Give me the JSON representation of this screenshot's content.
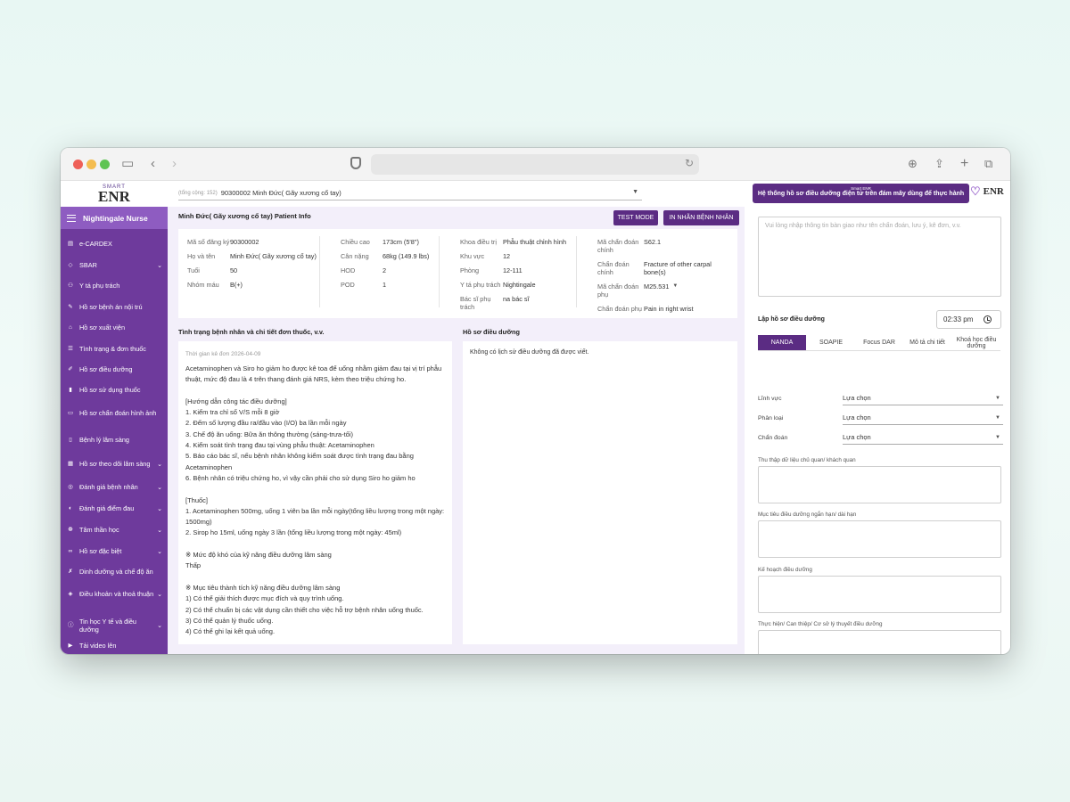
{
  "colors": {
    "primary": "#6e3a9c",
    "accent": "#5b2c83",
    "header": "#8e5cc1",
    "bg": "#f3effa"
  },
  "logo": {
    "small": "SMART",
    "big": "ENR"
  },
  "sidebar": {
    "title": "Nightingale Nurse",
    "items": [
      {
        "label": "e-CARDEX",
        "icon": "card-icon",
        "chevron": false
      },
      {
        "label": "SBAR",
        "icon": "diamond-icon",
        "chevron": true
      },
      {
        "label": "Y tá phụ trách",
        "icon": "people-icon",
        "chevron": false
      },
      {
        "label": "Hồ sơ bệnh án nội trú",
        "icon": "edit-icon",
        "chevron": false
      },
      {
        "label": "Hồ sơ xuất viện",
        "icon": "home-icon",
        "chevron": false
      },
      {
        "label": "Tình trạng & đơn thuốc",
        "icon": "list-icon",
        "chevron": false
      },
      {
        "label": "Hồ sơ điều dưỡng",
        "icon": "pen-icon",
        "chevron": false
      },
      {
        "label": "Hồ sơ sử dụng thuốc",
        "icon": "pill-icon",
        "chevron": false
      },
      {
        "label": "Hồ sơ chẩn đoán hình ảnh",
        "icon": "monitor-icon",
        "chevron": false
      },
      {
        "label": "Bệnh lý lâm sàng",
        "icon": "doc-icon",
        "chevron": false
      },
      {
        "label": "Hồ sơ theo dõi lâm sàng",
        "icon": "chart-icon",
        "chevron": true
      },
      {
        "label": "Đánh giá bệnh nhân",
        "icon": "target-icon",
        "chevron": true
      },
      {
        "label": "Đánh giá điểm đau",
        "icon": "scale-icon",
        "chevron": true
      },
      {
        "label": "Tâm thần học",
        "icon": "brain-icon",
        "chevron": true
      },
      {
        "label": "Hồ sơ đặc biệt",
        "icon": "glasses-icon",
        "chevron": true
      },
      {
        "label": "Dinh dưỡng và chế độ ăn",
        "icon": "food-icon",
        "chevron": false
      },
      {
        "label": "Điều khoản và thoả thuận",
        "icon": "shield-icon",
        "chevron": true
      },
      {
        "label": "Tin học Y tế và điều dưỡng",
        "icon": "info-icon",
        "chevron": true
      },
      {
        "label": "Tải video lên",
        "icon": "video-icon",
        "chevron": false
      }
    ]
  },
  "patient_select": {
    "count": "(tổng cộng: 152)",
    "value": "90300002 Minh Đức( Gãy xương cổ tay)"
  },
  "info_bar": {
    "title": "Minh Đức( Gãy xương cổ tay) Patient Info",
    "test_mode": "TEST MODE",
    "print_label": "IN NHÃN BỆNH NHÂN"
  },
  "patient_info": {
    "col1": [
      {
        "k": "Mã số đăng ký",
        "v": "90300002"
      },
      {
        "k": "Họ và tên",
        "v": "Minh Đức( Gãy xương cổ tay)"
      },
      {
        "k": "Tuổi",
        "v": "50"
      },
      {
        "k": "Nhóm máu",
        "v": "B(+)"
      }
    ],
    "col2": [
      {
        "k": "Chiều cao",
        "v": "173cm (5'8\")"
      },
      {
        "k": "Cân nặng",
        "v": "68kg (149.9 lbs)"
      },
      {
        "k": "HOD",
        "v": "2"
      },
      {
        "k": "POD",
        "v": "1"
      }
    ],
    "col3": [
      {
        "k": "Khoa điều trị",
        "v": "Phẫu thuật chỉnh hình"
      },
      {
        "k": "Khu vực",
        "v": "12"
      },
      {
        "k": "Phòng",
        "v": "12-111"
      },
      {
        "k": "Y tá phụ trách",
        "v": "Nightingale"
      },
      {
        "k": "Bác sĩ phụ trách",
        "v": "na bác sĩ"
      }
    ],
    "col4": [
      {
        "k": "Mã chẩn đoán chính",
        "v": "S62.1"
      },
      {
        "k": "Chẩn đoán chính",
        "v": "Fracture of other carpal bone(s)"
      },
      {
        "k": "Mã chẩn đoán phụ",
        "v": "M25.531"
      },
      {
        "k": "Chẩn đoán phụ",
        "v": "Pain in right wrist"
      }
    ]
  },
  "prescription": {
    "title": "Tình trạng bệnh nhân và chi tiết đơn thuốc, v.v.",
    "date": "Thời gian kê đơn 2026-04-09",
    "text": "Acetaminophen và Siro ho giảm ho được kê toa để uống nhằm giảm đau tại vị trí phẫu thuật, mức độ đau là 4 trên thang đánh giá NRS, kèm theo triệu chứng ho.\n\n[Hướng dẫn công tác điều dưỡng]\n1. Kiểm tra chỉ số V/S mỗi 8 giờ\n2. Đếm số lượng đầu ra/đầu vào (I/O) ba lần mỗi ngày\n3. Chế độ ăn uống: Bữa ăn thông thường (sáng-trưa-tối)\n4. Kiểm soát tình trạng đau tại vùng phẫu thuật: Acetaminophen\n5. Báo cáo bác sĩ, nếu bệnh nhân không kiểm soát được tình trạng đau bằng Acetaminophen\n6. Bệnh nhân có triệu chứng ho, vì vậy cần phải cho sử dụng Siro ho giảm ho\n\n[Thuốc]\n1. Acetaminophen 500mg, uống 1 viên ba lần mỗi ngày(tổng liều lượng trong một ngày: 1500mg)\n2. Sirop ho 15ml, uống ngày 3 lần (tổng liều lượng trong một ngày: 45ml)\n\n※ Mức độ khó của kỹ năng điều dưỡng lâm sàng\nThấp\n\n※ Mục tiêu thành tích kỹ năng điều dưỡng lâm sàng\n1) Có thể giải thích được mục đích và quy trình uống.\n2) Có thể chuẩn bị các vật dụng cần thiết cho việc hỗ trợ bệnh nhân uống thuốc.\n3) Có thể quản lý thuốc uống.\n4) Có thể ghi lại kết quả uống."
  },
  "nursing_history": {
    "title": "Hồ sơ điều dưỡng",
    "empty": "Không có lịch sử điều dưỡng đã được viết."
  },
  "right_panel": {
    "banner_small": "Smart ENR",
    "banner_text": "Hệ thống hồ sơ điều dưỡng điện tử trên đám mây dùng để thực hành",
    "logo_small": "SMART",
    "logo_big": "ENR",
    "handover_placeholder": "Vui lòng nhập thông tin bàn giao như tên chẩn đoán, lưu ý, kê đơn, v.v.",
    "record_title": "Lập hồ sơ điều dưỡng",
    "time": "02:33 pm",
    "tabs": [
      "NANDA",
      "SOAPIE",
      "Focus DAR",
      "Mô tả chi tiết",
      "Khoá học điều dưỡng"
    ],
    "fields": [
      {
        "label": "Lĩnh vực",
        "value": "Lựa chọn"
      },
      {
        "label": "Phân loại",
        "value": "Lựa chọn"
      },
      {
        "label": "Chẩn đoán",
        "value": "Lựa chọn"
      }
    ],
    "sections": [
      "Thu thập dữ liệu chủ quan/ khách quan",
      "Mục tiêu điều dưỡng ngắn hạn/ dài hạn",
      "Kế hoạch điều dưỡng",
      "Thực hiện/ Can thiệp/ Cơ sở lý thuyết điều dưỡng"
    ]
  }
}
